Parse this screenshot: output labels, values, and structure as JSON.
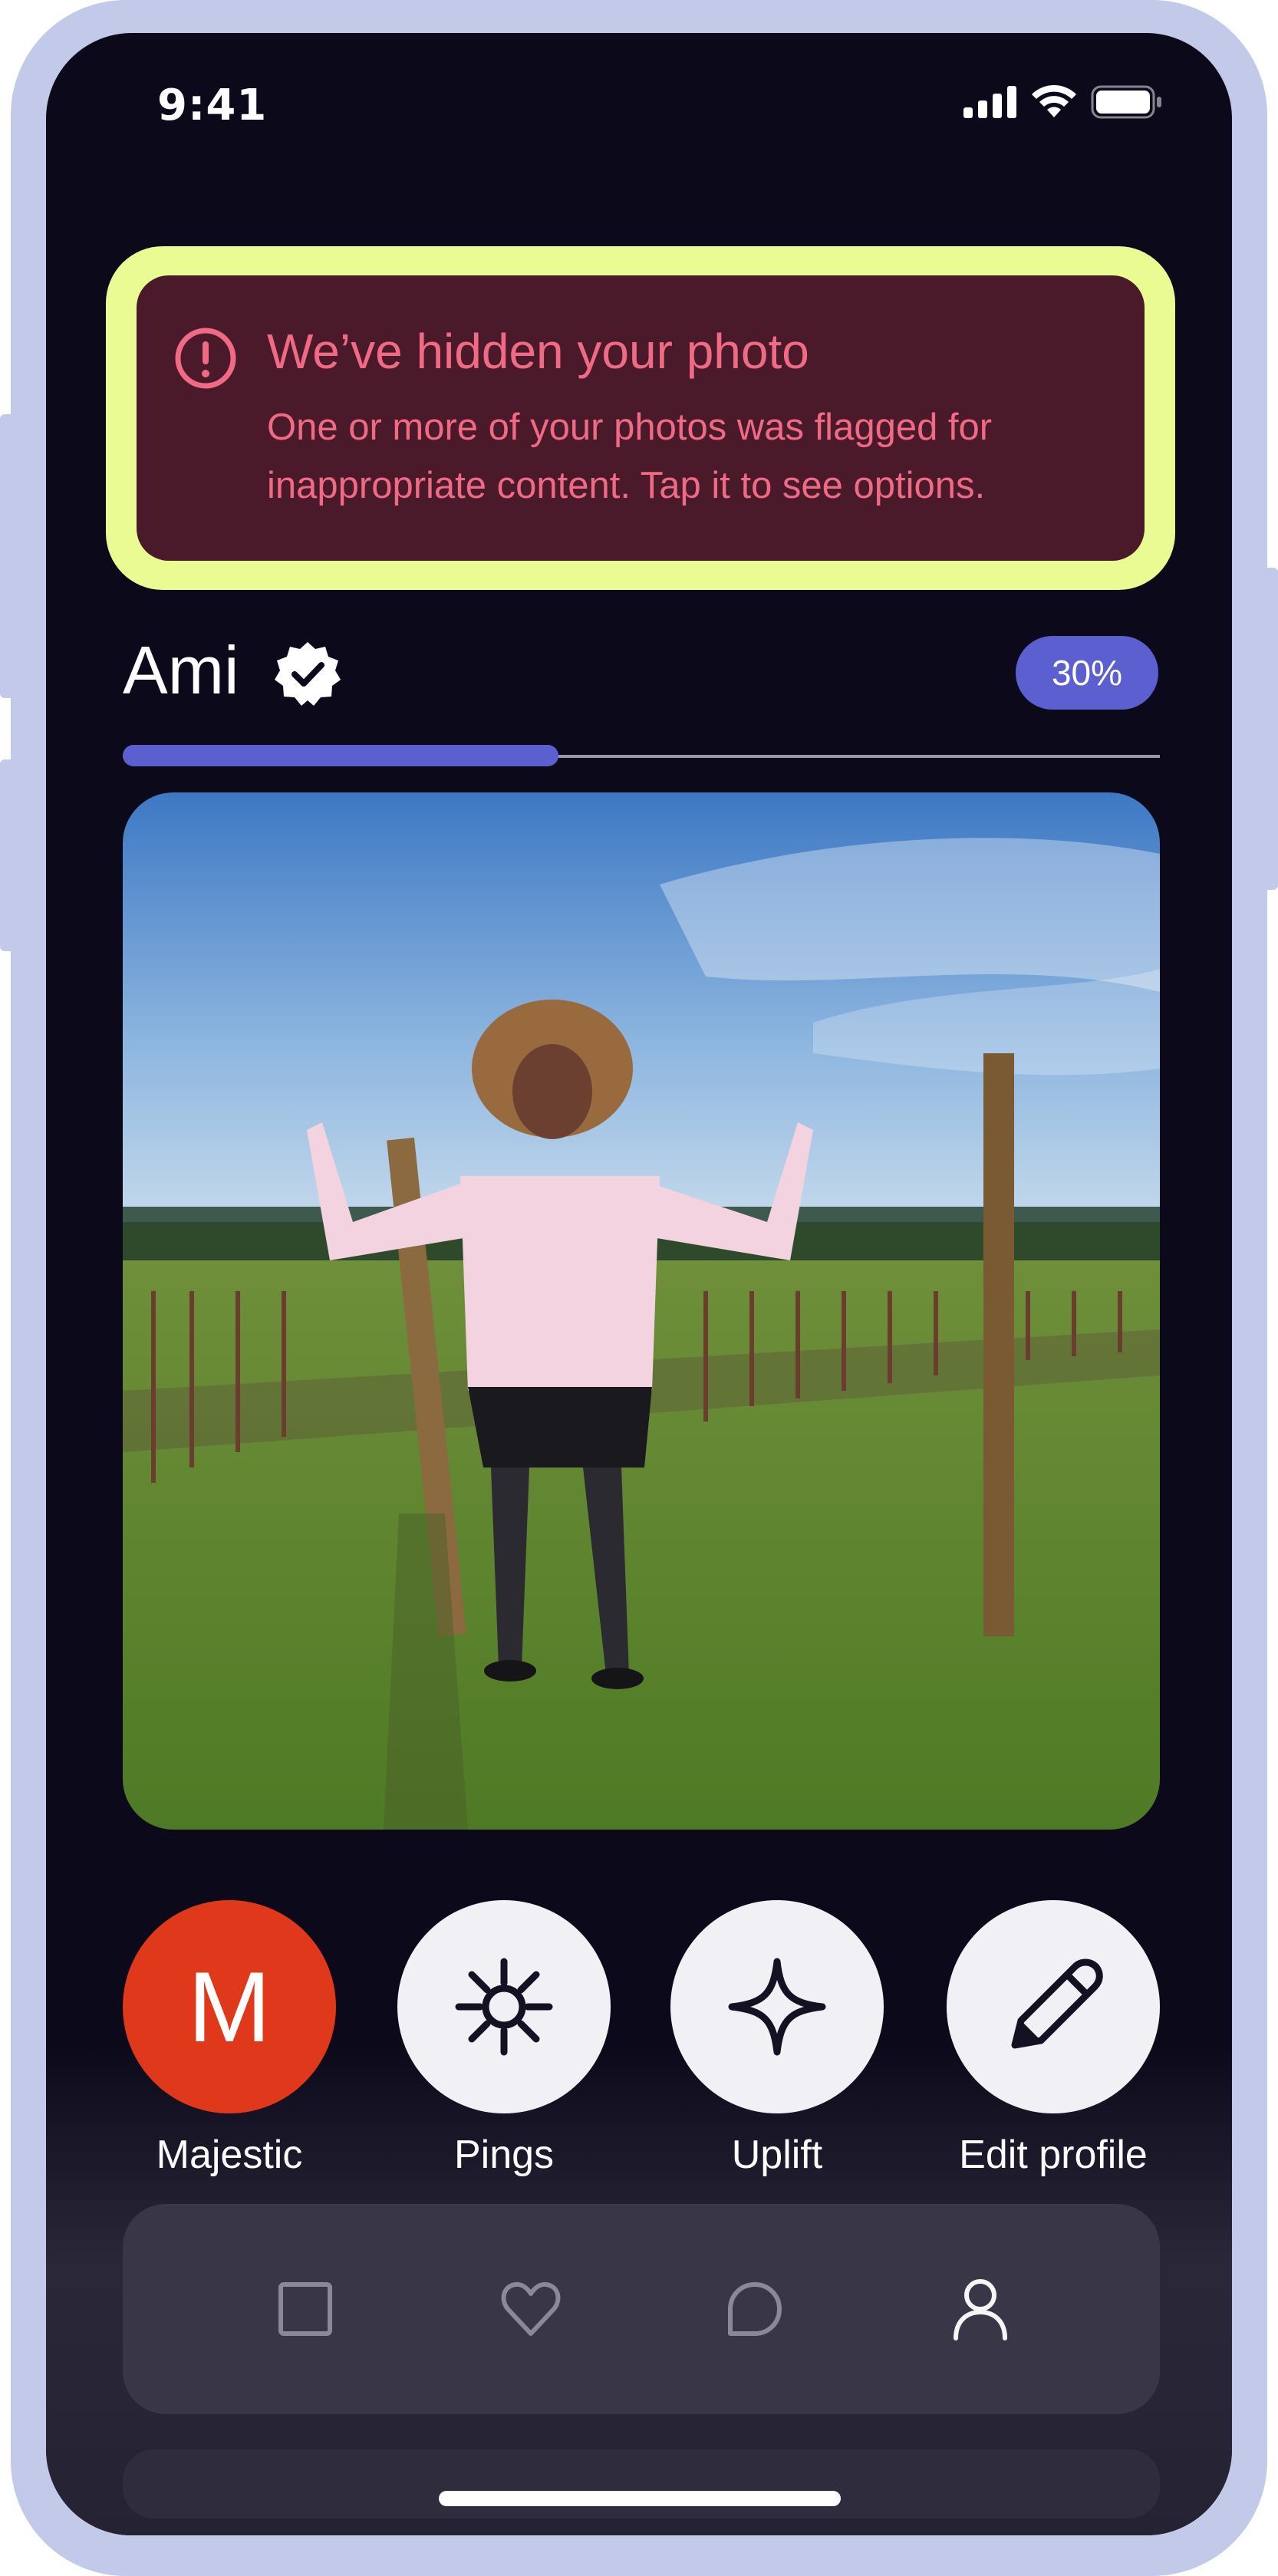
{
  "status_bar": {
    "time": "9:41",
    "icons": [
      "signal-icon",
      "wifi-icon",
      "battery-icon"
    ]
  },
  "alert": {
    "icon": "alert-circle-icon",
    "title": "We’ve hidden your photo",
    "body": "One or more of your photos was flagged for inappropriate content. Tap it to see options.",
    "colors": {
      "highlight": "#e9fb92",
      "background": "#4a1a2a",
      "text": "#f06a86"
    }
  },
  "profile": {
    "name": "Ami",
    "verified_icon": "verified-badge-icon",
    "completion_percent": 30,
    "completion_label": "30%"
  },
  "photo": {
    "icon": "profile-photo"
  },
  "actions": [
    {
      "label": "Majestic",
      "icon": "majestic-m-icon",
      "glyph": "M",
      "color": "#e0381a"
    },
    {
      "label": "Pings",
      "icon": "sparkle-asterisk-icon"
    },
    {
      "label": "Uplift",
      "icon": "four-point-star-icon"
    },
    {
      "label": "Edit profile",
      "icon": "pencil-icon"
    }
  ],
  "tabbar": {
    "items": [
      {
        "name": "home",
        "icon": "square-icon"
      },
      {
        "name": "likes",
        "icon": "heart-icon"
      },
      {
        "name": "messages",
        "icon": "chat-bubble-icon"
      },
      {
        "name": "profile",
        "icon": "person-icon",
        "active": true
      }
    ]
  }
}
